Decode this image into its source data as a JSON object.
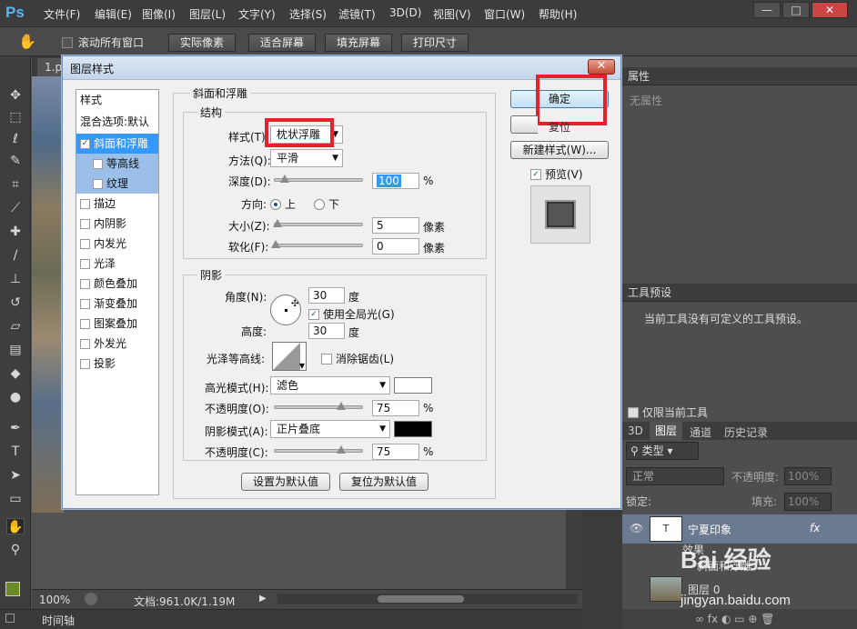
{
  "app": {
    "logo": "Ps"
  },
  "menu": [
    "文件(F)",
    "编辑(E)",
    "图像(I)",
    "图层(L)",
    "文字(Y)",
    "选择(S)",
    "滤镜(T)",
    "3D(D)",
    "视图(V)",
    "窗口(W)",
    "帮助(H)"
  ],
  "window_controls": {
    "minimize": "—",
    "restore": "□",
    "close": "✕"
  },
  "options": {
    "scroll_all_label": "滚动所有窗口",
    "buttons": [
      "实际像素",
      "适合屏幕",
      "填充屏幕",
      "打印尺寸"
    ]
  },
  "document": {
    "tab": "1.p",
    "zoom": "100%",
    "doc_info": "文档:961.0K/1.19M",
    "timeline": "时间轴"
  },
  "dialog": {
    "title": "图层样式",
    "close": "✕",
    "styles_header": "样式",
    "blend_options": "混合选项:默认",
    "style_items": [
      {
        "label": "斜面和浮雕",
        "checked": true
      },
      {
        "label": "等高线",
        "checked": false
      },
      {
        "label": "纹理",
        "checked": false
      },
      {
        "label": "描边",
        "checked": false
      },
      {
        "label": "内阴影",
        "checked": false
      },
      {
        "label": "内发光",
        "checked": false
      },
      {
        "label": "光泽",
        "checked": false
      },
      {
        "label": "颜色叠加",
        "checked": false
      },
      {
        "label": "渐变叠加",
        "checked": false
      },
      {
        "label": "图案叠加",
        "checked": false
      },
      {
        "label": "外发光",
        "checked": false
      },
      {
        "label": "投影",
        "checked": false
      }
    ],
    "bevel": {
      "section_title": "斜面和浮雕",
      "structure_title": "结构",
      "style_label": "样式(T):",
      "style_value": "枕状浮雕",
      "technique_label": "方法(Q):",
      "technique_value": "平滑",
      "depth_label": "深度(D):",
      "depth_value": "100",
      "depth_unit": "%",
      "direction_label": "方向:",
      "dir_up": "上",
      "dir_down": "下",
      "size_label": "大小(Z):",
      "size_value": "5",
      "size_unit": "像素",
      "soften_label": "软化(F):",
      "soften_value": "0",
      "soften_unit": "像素"
    },
    "shading": {
      "title": "阴影",
      "angle_label": "角度(N):",
      "angle_value": "30",
      "angle_unit": "度",
      "global_light_label": "使用全局光(G)",
      "altitude_label": "高度:",
      "altitude_value": "30",
      "altitude_unit": "度",
      "gloss_label": "光泽等高线:",
      "antialias_label": "消除锯齿(L)",
      "highlight_mode_label": "高光模式(H):",
      "highlight_mode_value": "滤色",
      "highlight_color": "#ffffff",
      "highlight_opacity_label": "不透明度(O):",
      "highlight_opacity_value": "75",
      "shadow_mode_label": "阴影模式(A):",
      "shadow_mode_value": "正片叠底",
      "shadow_color": "#000000",
      "shadow_opacity_label": "不透明度(C):",
      "shadow_opacity_value": "75",
      "pct": "%"
    },
    "default_buttons": {
      "set": "设置为默认值",
      "reset": "复位为默认值"
    },
    "right": {
      "ok": "确定",
      "reset": "复位",
      "new_style": "新建样式(W)...",
      "preview": "预览(V)"
    }
  },
  "panels": {
    "properties_title": "属性",
    "properties_body": "无属性",
    "tool_presets_title": "工具预设",
    "tool_presets_body": "当前工具没有可定义的工具预设。",
    "current_tool_only": "仅限当前工具",
    "layer_tabs": [
      "3D",
      "图层",
      "通道",
      "历史记录"
    ],
    "kind_label": "类型",
    "blend_mode": "正常",
    "opacity_label": "不透明度:",
    "opacity_value": "100%",
    "lock_label": "锁定:",
    "fill_label": "填充:",
    "fill_value": "100%",
    "layers": [
      {
        "name": "宁夏印象",
        "fx": "fx"
      },
      {
        "name": "效果"
      },
      {
        "name": "斜面和浮雕"
      },
      {
        "name": "图层 0"
      }
    ]
  },
  "watermark": {
    "text": "Bai 经验",
    "url": "jingyan.baidu.com"
  }
}
